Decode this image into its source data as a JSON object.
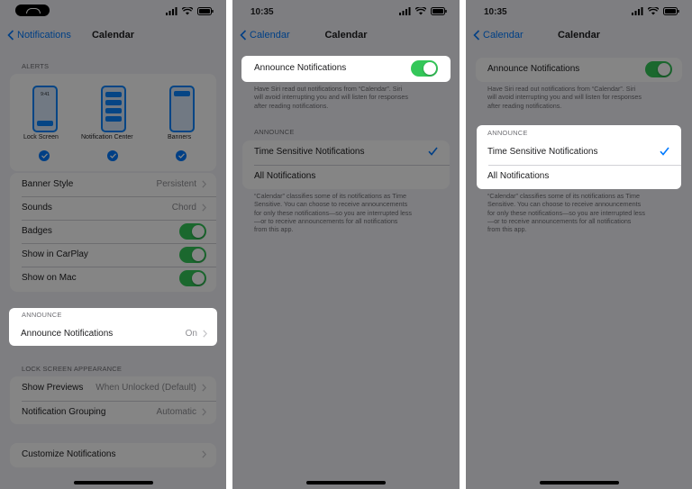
{
  "screen1": {
    "nav": {
      "back_label": "Notifications",
      "title": "Calendar"
    },
    "alerts_header": "ALERTS",
    "alert_styles": [
      {
        "label": "Lock Screen",
        "preview_time": "9:41",
        "checked": true
      },
      {
        "label": "Notification Center",
        "checked": true
      },
      {
        "label": "Banners",
        "checked": true
      }
    ],
    "rows": [
      {
        "label": "Banner Style",
        "value": "Persistent"
      },
      {
        "label": "Sounds",
        "value": "Chord"
      },
      {
        "label": "Badges",
        "toggle": true
      },
      {
        "label": "Show in CarPlay",
        "toggle": true
      },
      {
        "label": "Show on Mac",
        "toggle": true
      }
    ],
    "announce_header": "ANNOUNCE",
    "announce_row": {
      "label": "Announce Notifications",
      "value": "On"
    },
    "lock_header": "LOCK SCREEN APPEARANCE",
    "lock_rows": [
      {
        "label": "Show Previews",
        "value": "When Unlocked (Default)"
      },
      {
        "label": "Notification Grouping",
        "value": "Automatic"
      }
    ],
    "customize_label": "Customize Notifications"
  },
  "screen2": {
    "time": "10:35",
    "nav": {
      "back_label": "Calendar",
      "title": "Calendar"
    },
    "announce_toggle_label": "Announce Notifications",
    "announce_toggle_on": true,
    "description_lines": [
      "Have Siri read out notifications from “Calendar”. Siri",
      "will avoid interrupting you and will listen for responses",
      "after reading notifications."
    ],
    "announce_header": "ANNOUNCE",
    "options": [
      {
        "label": "Time Sensitive Notifications",
        "selected": true
      },
      {
        "label": "All Notifications",
        "selected": false
      }
    ],
    "footer_lines": [
      "“Calendar” classifies some of its notifications as Time",
      "Sensitive. You can choose to receive announcements",
      "for only these notifications—so you are interrupted less",
      "—or to receive announcements for all notifications",
      "from this app."
    ]
  },
  "screen3": {
    "time": "10:35",
    "nav": {
      "back_label": "Calendar",
      "title": "Calendar"
    },
    "announce_toggle_label": "Announce Notifications",
    "description_lines": [
      "Have Siri read out notifications from “Calendar”. Siri",
      "will avoid interrupting you and will listen for responses",
      "after reading notifications."
    ],
    "announce_header": "ANNOUNCE",
    "options": [
      {
        "label": "Time Sensitive Notifications",
        "selected": true
      },
      {
        "label": "All Notifications",
        "selected": false
      }
    ],
    "footer_lines": [
      "“Calendar” classifies some of its notifications as Time",
      "Sensitive. You can choose to receive announcements",
      "for only these notifications—so you are interrupted less",
      "—or to receive announcements for all notifications",
      "from this app."
    ]
  },
  "colors": {
    "accent": "#007aff",
    "toggle_on": "#34c759",
    "dim_overlay": "rgba(0,0,0,0.48)"
  }
}
